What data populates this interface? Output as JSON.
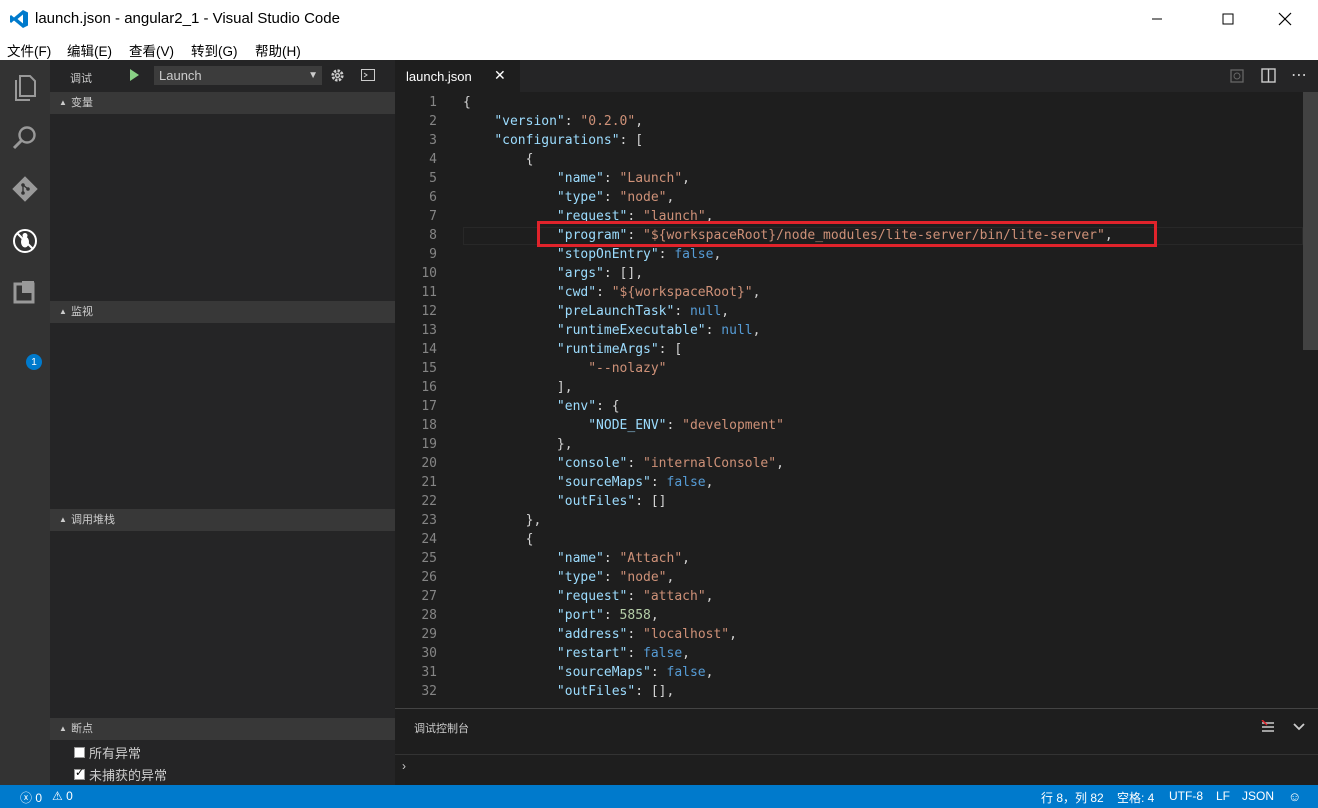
{
  "window": {
    "title": "launch.json - angular2_1 - Visual Studio Code"
  },
  "menu": [
    "文件(F)",
    "编辑(E)",
    "查看(V)",
    "转到(G)",
    "帮助(H)"
  ],
  "activity": {
    "extensions_badge": "1"
  },
  "debug": {
    "label": "调试",
    "config_selected": "Launch",
    "sections": {
      "variables": "变量",
      "watch": "监视",
      "callstack": "调用堆栈",
      "breakpoints": "断点"
    },
    "breakpoints": [
      {
        "label": "所有异常",
        "checked": false
      },
      {
        "label": "未捕获的异常",
        "checked": true
      }
    ]
  },
  "editor": {
    "tab": "launch.json",
    "lines": [
      [
        [
          "p",
          "{"
        ]
      ],
      [
        [
          "p",
          "    "
        ],
        [
          "k",
          "\"version\""
        ],
        [
          "p",
          ": "
        ],
        [
          "s",
          "\"0.2.0\""
        ],
        [
          "p",
          ","
        ]
      ],
      [
        [
          "p",
          "    "
        ],
        [
          "k",
          "\"configurations\""
        ],
        [
          "p",
          ": ["
        ]
      ],
      [
        [
          "p",
          "        {"
        ]
      ],
      [
        [
          "p",
          "            "
        ],
        [
          "k",
          "\"name\""
        ],
        [
          "p",
          ": "
        ],
        [
          "s",
          "\"Launch\""
        ],
        [
          "p",
          ","
        ]
      ],
      [
        [
          "p",
          "            "
        ],
        [
          "k",
          "\"type\""
        ],
        [
          "p",
          ": "
        ],
        [
          "s",
          "\"node\""
        ],
        [
          "p",
          ","
        ]
      ],
      [
        [
          "p",
          "            "
        ],
        [
          "k",
          "\"request\""
        ],
        [
          "p",
          ": "
        ],
        [
          "s",
          "\"launch\""
        ],
        [
          "p",
          ","
        ]
      ],
      [
        [
          "p",
          "            "
        ],
        [
          "k",
          "\"program\""
        ],
        [
          "p",
          ": "
        ],
        [
          "s",
          "\"${workspaceRoot}/node_modules/lite-server/bin/lite-server\""
        ],
        [
          "p",
          ","
        ]
      ],
      [
        [
          "p",
          "            "
        ],
        [
          "k",
          "\"stopOnEntry\""
        ],
        [
          "p",
          ": "
        ],
        [
          "b",
          "false"
        ],
        [
          "p",
          ","
        ]
      ],
      [
        [
          "p",
          "            "
        ],
        [
          "k",
          "\"args\""
        ],
        [
          "p",
          ": [],"
        ]
      ],
      [
        [
          "p",
          "            "
        ],
        [
          "k",
          "\"cwd\""
        ],
        [
          "p",
          ": "
        ],
        [
          "s",
          "\"${workspaceRoot}\""
        ],
        [
          "p",
          ","
        ]
      ],
      [
        [
          "p",
          "            "
        ],
        [
          "k",
          "\"preLaunchTask\""
        ],
        [
          "p",
          ": "
        ],
        [
          "b",
          "null"
        ],
        [
          "p",
          ","
        ]
      ],
      [
        [
          "p",
          "            "
        ],
        [
          "k",
          "\"runtimeExecutable\""
        ],
        [
          "p",
          ": "
        ],
        [
          "b",
          "null"
        ],
        [
          "p",
          ","
        ]
      ],
      [
        [
          "p",
          "            "
        ],
        [
          "k",
          "\"runtimeArgs\""
        ],
        [
          "p",
          ": ["
        ]
      ],
      [
        [
          "p",
          "                "
        ],
        [
          "s",
          "\"--nolazy\""
        ]
      ],
      [
        [
          "p",
          "            ],"
        ]
      ],
      [
        [
          "p",
          "            "
        ],
        [
          "k",
          "\"env\""
        ],
        [
          "p",
          ": {"
        ]
      ],
      [
        [
          "p",
          "                "
        ],
        [
          "k",
          "\"NODE_ENV\""
        ],
        [
          "p",
          ": "
        ],
        [
          "s",
          "\"development\""
        ]
      ],
      [
        [
          "p",
          "            },"
        ]
      ],
      [
        [
          "p",
          "            "
        ],
        [
          "k",
          "\"console\""
        ],
        [
          "p",
          ": "
        ],
        [
          "s",
          "\"internalConsole\""
        ],
        [
          "p",
          ","
        ]
      ],
      [
        [
          "p",
          "            "
        ],
        [
          "k",
          "\"sourceMaps\""
        ],
        [
          "p",
          ": "
        ],
        [
          "b",
          "false"
        ],
        [
          "p",
          ","
        ]
      ],
      [
        [
          "p",
          "            "
        ],
        [
          "k",
          "\"outFiles\""
        ],
        [
          "p",
          ": []"
        ]
      ],
      [
        [
          "p",
          "        },"
        ]
      ],
      [
        [
          "p",
          "        {"
        ]
      ],
      [
        [
          "p",
          "            "
        ],
        [
          "k",
          "\"name\""
        ],
        [
          "p",
          ": "
        ],
        [
          "s",
          "\"Attach\""
        ],
        [
          "p",
          ","
        ]
      ],
      [
        [
          "p",
          "            "
        ],
        [
          "k",
          "\"type\""
        ],
        [
          "p",
          ": "
        ],
        [
          "s",
          "\"node\""
        ],
        [
          "p",
          ","
        ]
      ],
      [
        [
          "p",
          "            "
        ],
        [
          "k",
          "\"request\""
        ],
        [
          "p",
          ": "
        ],
        [
          "s",
          "\"attach\""
        ],
        [
          "p",
          ","
        ]
      ],
      [
        [
          "p",
          "            "
        ],
        [
          "k",
          "\"port\""
        ],
        [
          "p",
          ": "
        ],
        [
          "n",
          "5858"
        ],
        [
          "p",
          ","
        ]
      ],
      [
        [
          "p",
          "            "
        ],
        [
          "k",
          "\"address\""
        ],
        [
          "p",
          ": "
        ],
        [
          "s",
          "\"localhost\""
        ],
        [
          "p",
          ","
        ]
      ],
      [
        [
          "p",
          "            "
        ],
        [
          "k",
          "\"restart\""
        ],
        [
          "p",
          ": "
        ],
        [
          "b",
          "false"
        ],
        [
          "p",
          ","
        ]
      ],
      [
        [
          "p",
          "            "
        ],
        [
          "k",
          "\"sourceMaps\""
        ],
        [
          "p",
          ": "
        ],
        [
          "b",
          "false"
        ],
        [
          "p",
          ","
        ]
      ],
      [
        [
          "p",
          "            "
        ],
        [
          "k",
          "\"outFiles\""
        ],
        [
          "p",
          ": [],"
        ]
      ]
    ]
  },
  "panel": {
    "title": "调试控制台",
    "prompt": "›"
  },
  "status": {
    "errors": "0",
    "warnings": "0",
    "position": "行 8，列 82",
    "indent": "空格: 4",
    "encoding": "UTF-8",
    "eol": "LF",
    "language": "JSON"
  },
  "colors": {
    "accent": "#007acc",
    "highlight": "#e0232b"
  }
}
